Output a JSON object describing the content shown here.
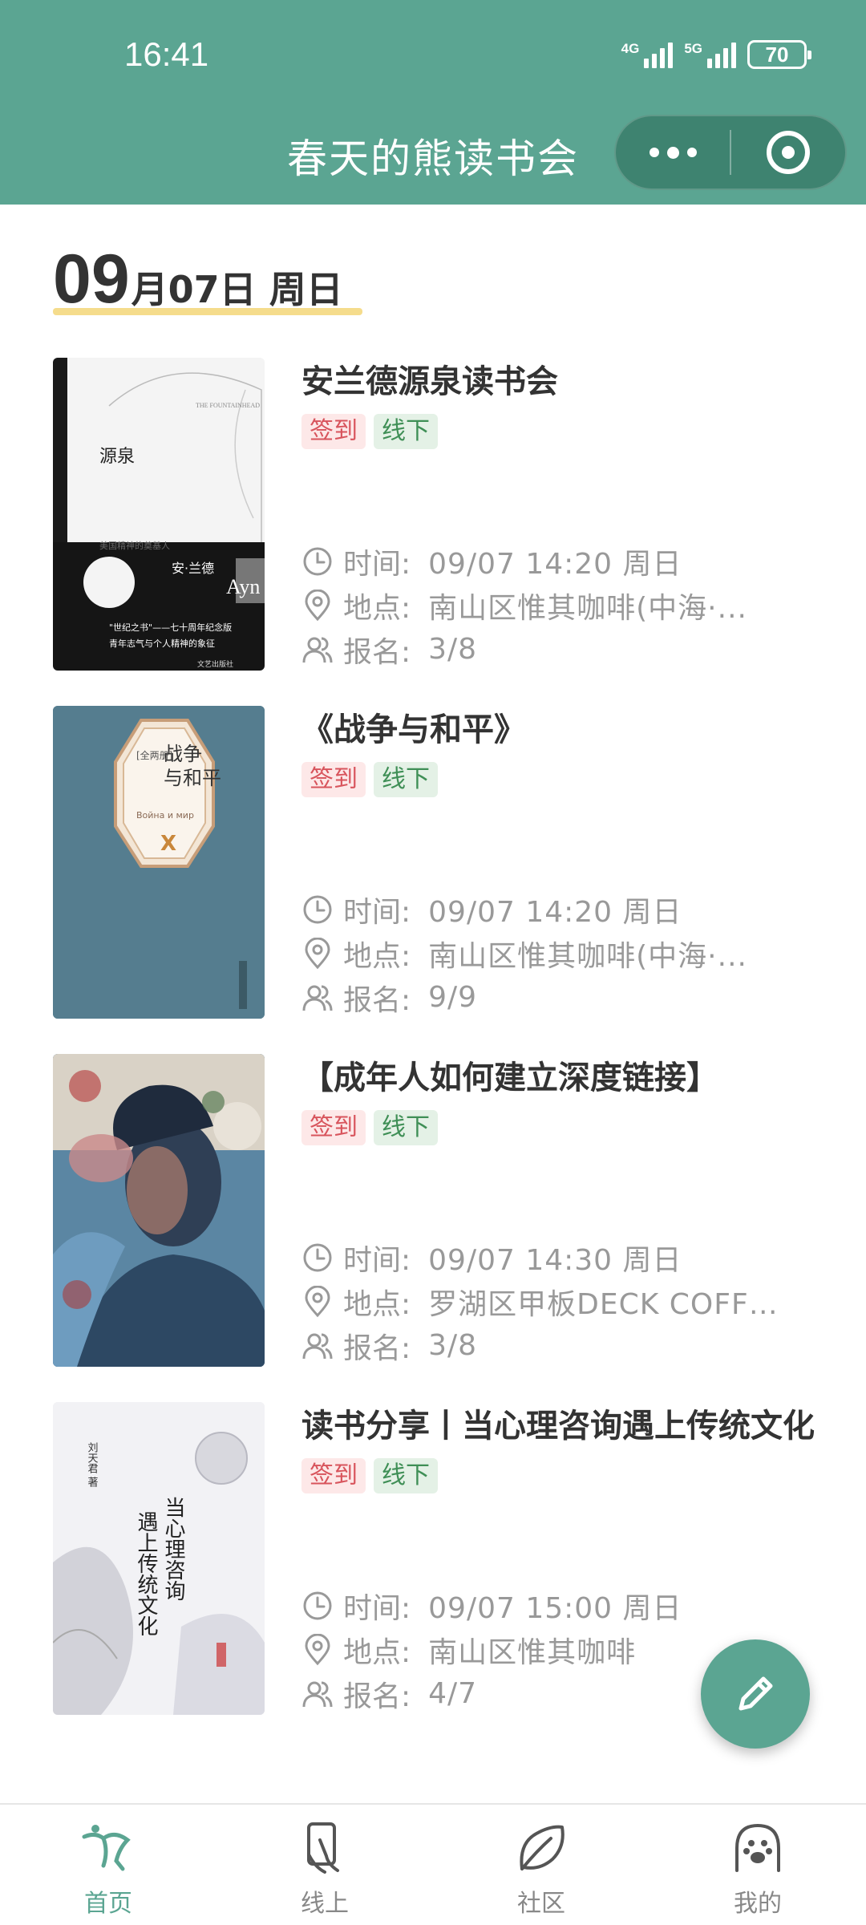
{
  "status_bar": {
    "time": "16:41",
    "signal1": "4G",
    "signal2": "5G",
    "battery": "70"
  },
  "header": {
    "title": "春天的熊读书会"
  },
  "date_heading": {
    "month": "09",
    "rest": "月07日 周日"
  },
  "labels": {
    "time": "时间:",
    "place": "地点:",
    "signup": "报名:"
  },
  "events": [
    {
      "title": "安兰德源泉读书会",
      "tags": [
        "签到",
        "线下"
      ],
      "time": "09/07  14:20  周日",
      "place": "南山区惟其咖啡(中海·...",
      "signup": "3/8",
      "cover": {
        "title_cn": "源泉",
        "en_title": "THE FOUNTAINHEAD",
        "author_cn": "安·兰德",
        "author_en": "Ayn Rand",
        "subtitle": "\"世纪之书\"——七十周年纪念版",
        "tagline": "青年志气与个人精神的象征",
        "blurb": "美国精神的奠基人",
        "publisher": "文艺出版社"
      }
    },
    {
      "title": "《战争与和平》",
      "tags": [
        "签到",
        "线下"
      ],
      "time": "09/07  14:20  周日",
      "place": "南山区惟其咖啡(中海·...",
      "signup": "9/9",
      "cover": {
        "title_cn": "战争与和平",
        "subtitle": "[全两册]",
        "en": "Война и мир"
      }
    },
    {
      "title": "【成年人如何建立深度链接】",
      "tags": [
        "签到",
        "线下"
      ],
      "time": "09/07  14:30  周日",
      "place": "罗湖区甲板DECK  COFFE...",
      "signup": "3/8",
      "cover": {}
    },
    {
      "title": "读书分享丨当心理咨询遇上传统文化",
      "tags": [
        "签到",
        "线下"
      ],
      "time": "09/07  15:00  周日",
      "place": "南山区惟其咖啡",
      "signup": "4/7",
      "cover": {
        "title": "当心理咨询遇上传统文化",
        "author": "刘天君 著"
      }
    }
  ],
  "tabbar": [
    {
      "label": "首页",
      "icon": "dancer-icon",
      "active": true
    },
    {
      "label": "线上",
      "icon": "phone-hand-icon",
      "active": false
    },
    {
      "label": "社区",
      "icon": "leaf-icon",
      "active": false
    },
    {
      "label": "我的",
      "icon": "paw-face-icon",
      "active": false
    }
  ],
  "colors": {
    "primary": "#5ba592",
    "capsule": "#3e8370",
    "checkin_tag": "#d8545c",
    "offline_tag": "#3f8f56",
    "date_underline": "#f5dc8c"
  }
}
